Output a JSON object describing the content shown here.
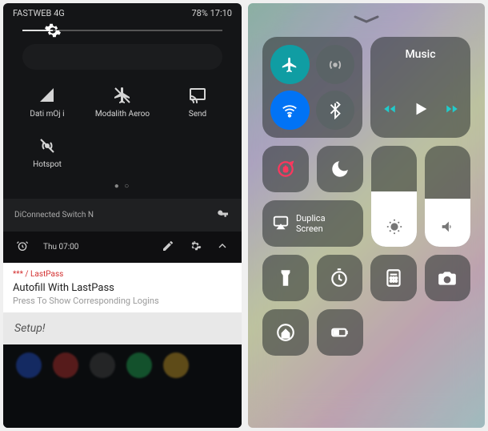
{
  "android": {
    "status": {
      "carrier": "FASTWEB 4G",
      "battery": "78%",
      "time": "17:10"
    },
    "brightness_pct": 15,
    "qs": [
      {
        "name": "mobile-data",
        "label": "Dati mOj i"
      },
      {
        "name": "airplane",
        "label": "Modalith Aeroo"
      },
      {
        "name": "cast",
        "label": "Send"
      },
      {
        "name": "hotspot",
        "label": "Hotspot"
      }
    ],
    "mid": {
      "text": "DiConnected Switch N"
    },
    "alarm": {
      "text": "Thu 07:00"
    },
    "notif": {
      "app": "*** / LastPass",
      "title": "Autofill With LastPass",
      "sub": "Press To Show Corresponding Logins"
    },
    "setup": "Setup!"
  },
  "ios": {
    "music_label": "Music",
    "mirror_label": "Duplica Screen",
    "brightness_pct": 55,
    "volume_pct": 48
  }
}
